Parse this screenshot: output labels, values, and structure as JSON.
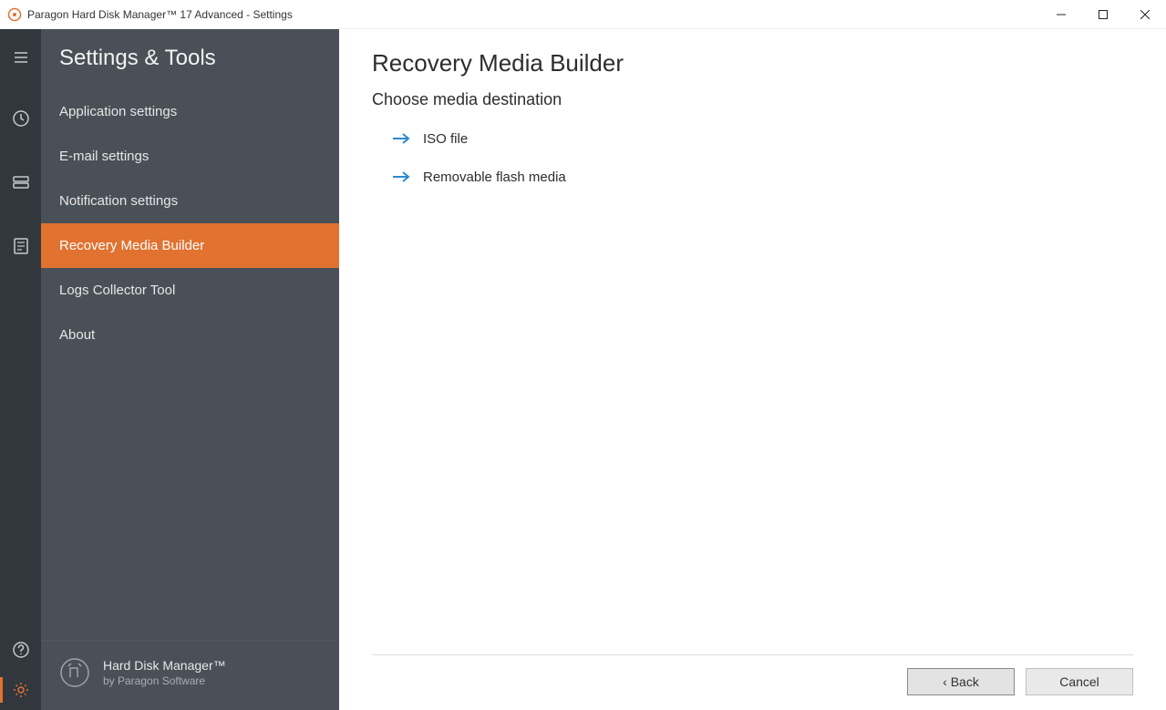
{
  "window": {
    "title": "Paragon Hard Disk Manager™ 17 Advanced - Settings"
  },
  "sidebar": {
    "title": "Settings & Tools",
    "items": [
      {
        "label": "Application settings",
        "active": false
      },
      {
        "label": "E-mail settings",
        "active": false
      },
      {
        "label": "Notification settings",
        "active": false
      },
      {
        "label": "Recovery Media Builder",
        "active": true
      },
      {
        "label": "Logs Collector Tool",
        "active": false
      },
      {
        "label": "About",
        "active": false
      }
    ],
    "product": {
      "name": "Hard Disk Manager™",
      "by": "by Paragon Software"
    }
  },
  "content": {
    "title": "Recovery Media Builder",
    "subtitle": "Choose media destination",
    "options": [
      {
        "label": "ISO file"
      },
      {
        "label": "Removable flash media"
      }
    ]
  },
  "footer": {
    "back": "‹ Back",
    "cancel": "Cancel"
  }
}
